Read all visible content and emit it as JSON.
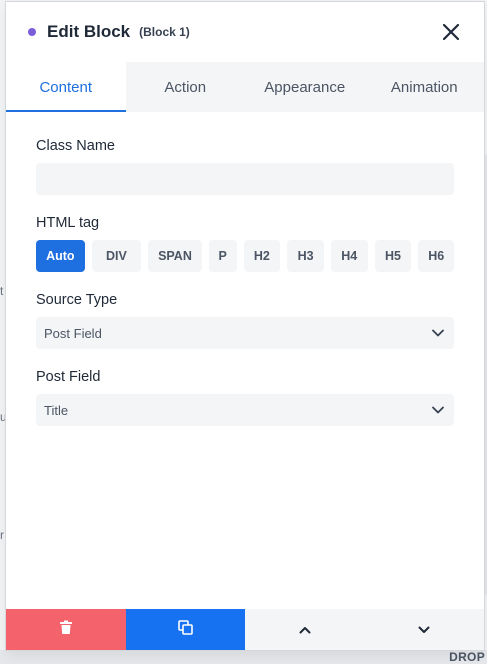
{
  "background": {
    "fragments": [
      "t",
      "u",
      "r"
    ],
    "drop_label": "DROP"
  },
  "panel": {
    "title": "Edit Block",
    "subtitle": "(Block 1)",
    "accent_dot_color": "#7c5cdb",
    "close_icon": "close-icon"
  },
  "tabs": [
    {
      "label": "Content",
      "active": true
    },
    {
      "label": "Action",
      "active": false
    },
    {
      "label": "Appearance",
      "active": false
    },
    {
      "label": "Animation",
      "active": false
    }
  ],
  "fields": {
    "class_name": {
      "label": "Class Name",
      "value": "",
      "placeholder": ""
    },
    "html_tag": {
      "label": "HTML tag",
      "options": [
        "Auto",
        "DIV",
        "SPAN",
        "P",
        "H2",
        "H3",
        "H4",
        "H5",
        "H6"
      ],
      "selected": "Auto"
    },
    "source_type": {
      "label": "Source Type",
      "value": "Post Field"
    },
    "post_field": {
      "label": "Post Field",
      "value": "Title"
    }
  },
  "footer": {
    "delete_icon": "trash-icon",
    "copy_icon": "copy-icon",
    "up_icon": "chevron-up-icon",
    "down_icon": "chevron-down-icon"
  },
  "colors": {
    "primary": "#1e6fe0",
    "danger": "#f4636c",
    "copy": "#1672f0"
  }
}
